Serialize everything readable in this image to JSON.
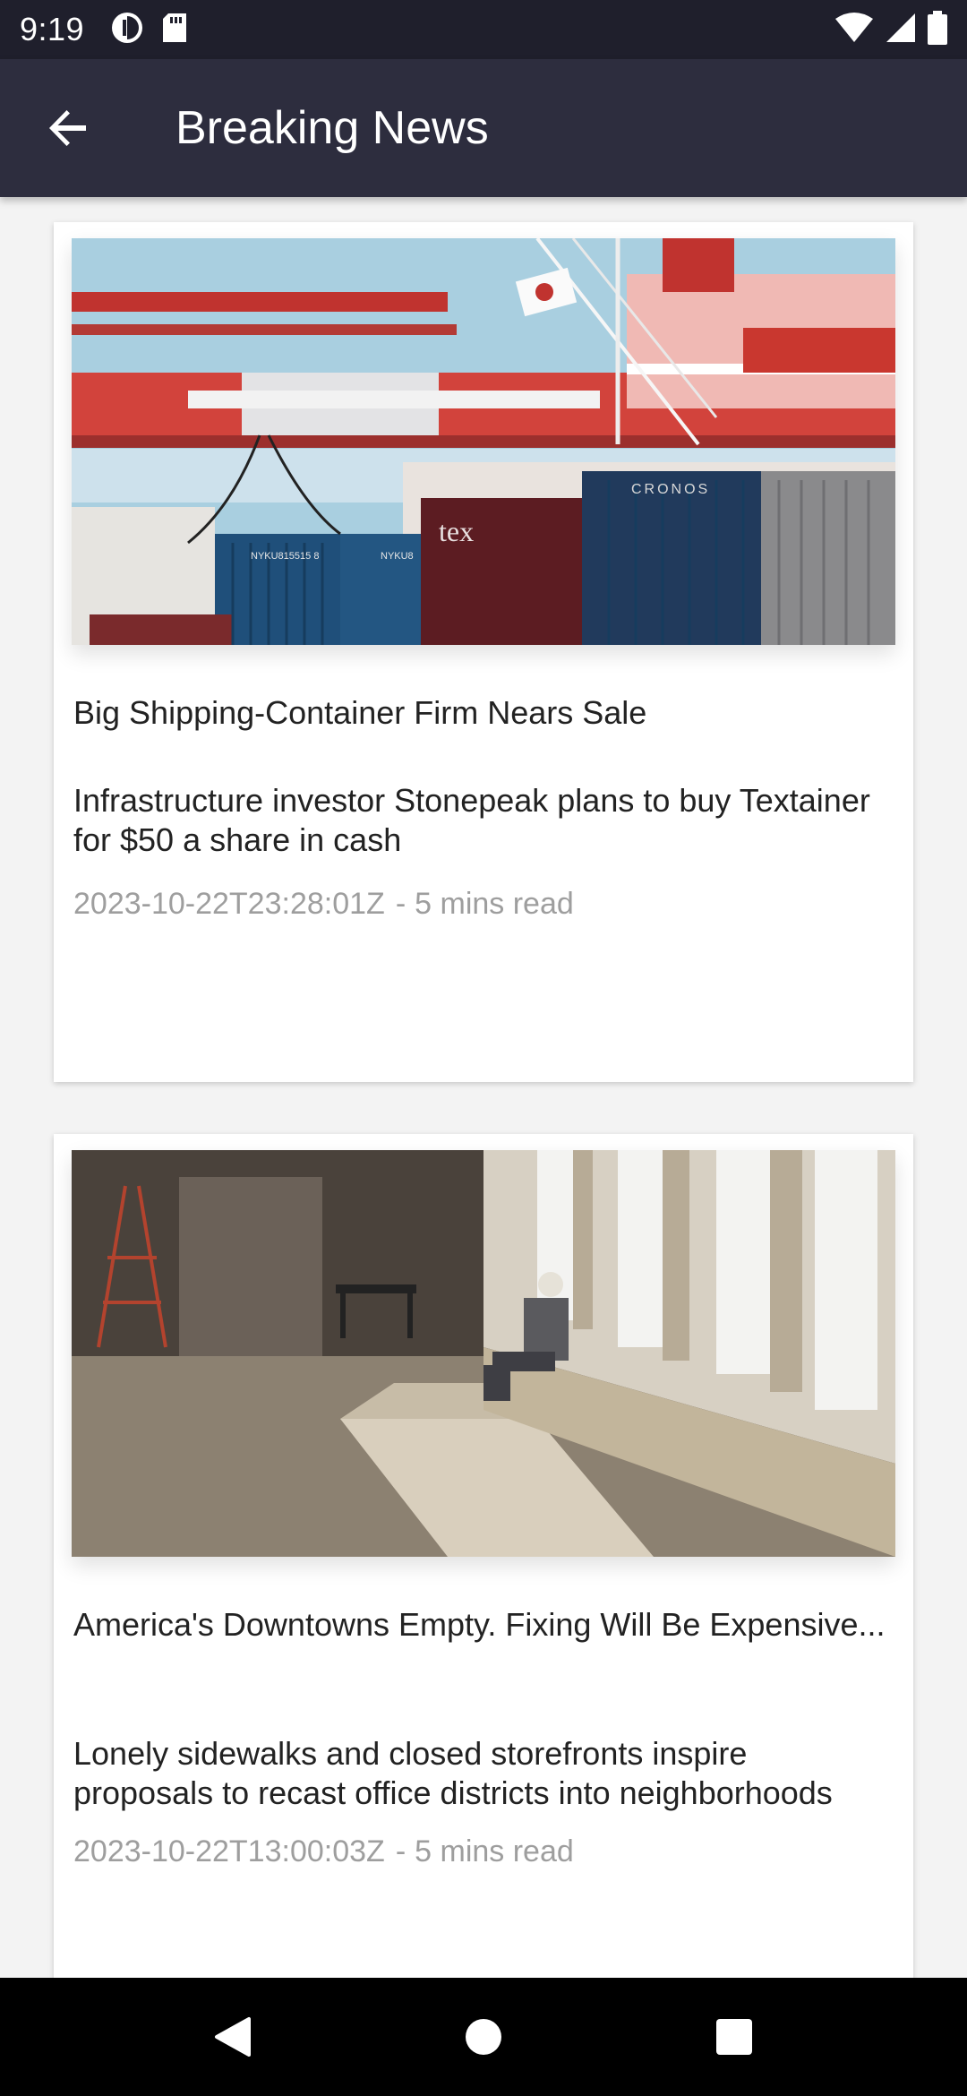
{
  "status_bar": {
    "time": "9:19"
  },
  "app_bar": {
    "title": "Breaking News"
  },
  "articles": [
    {
      "title": "Big Shipping-Container Firm Nears Sale",
      "description": "Infrastructure investor Stonepeak plans to buy Textainer for $50 a share in cash",
      "published": "2023-10-22T23:28:01Z",
      "read_time": "5 mins read",
      "image_text": [
        "tex",
        "CRONOS",
        "NYKU815515 8",
        "NYKU8"
      ]
    },
    {
      "title": "America's Downtowns Empty. Fixing Will Be Expensive...",
      "description": "Lonely sidewalks and closed storefronts inspire proposals to recast office districts into neighborhoods",
      "published": "2023-10-22T13:00:03Z",
      "read_time": "5 mins read"
    }
  ],
  "meta_separator": "-",
  "icons": {
    "back": "arrow-left-icon",
    "wifi": "wifi-icon",
    "signal": "cell-signal-icon",
    "battery": "battery-icon",
    "nav_back": "triangle-back-icon",
    "nav_home": "circle-home-icon",
    "nav_recents": "square-recents-icon"
  },
  "colors": {
    "status_bar": "#1f1f2c",
    "app_bar": "#2d2d3e",
    "background": "#f3f3f3",
    "card": "#ffffff",
    "meta_text": "#9e9e9e",
    "nav_bar": "#000000"
  }
}
